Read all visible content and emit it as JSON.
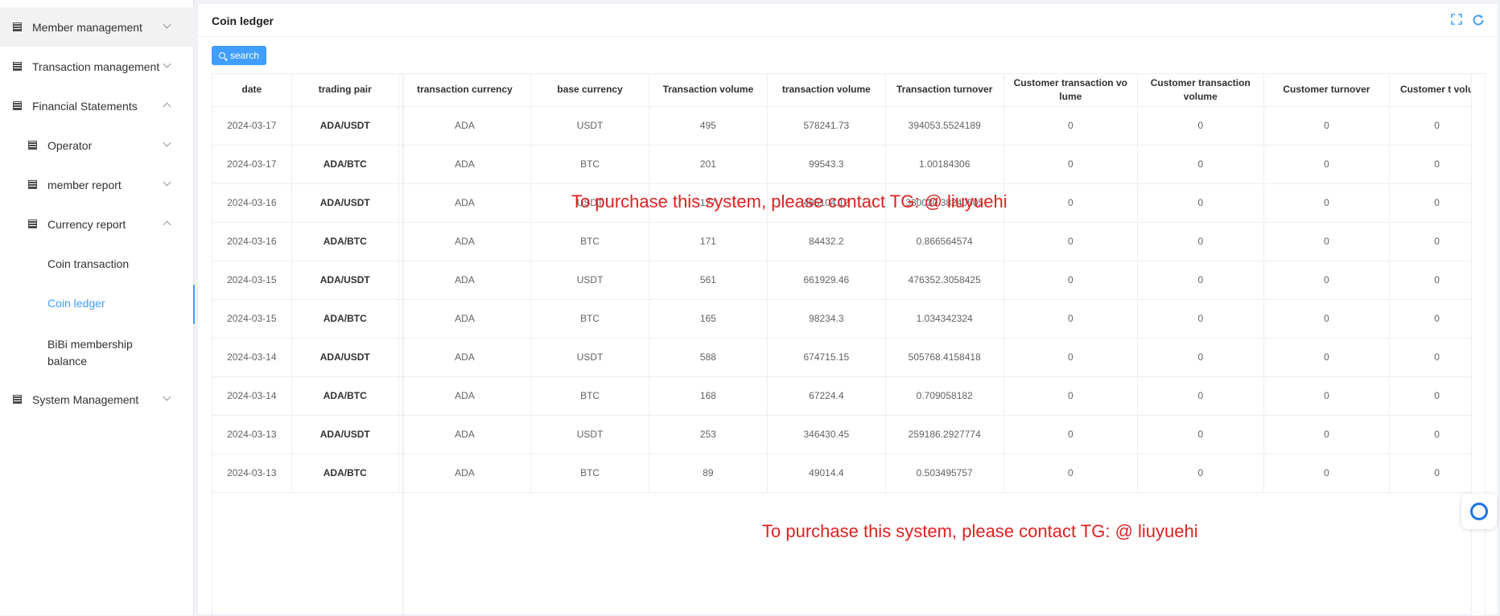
{
  "sidebar": {
    "items": [
      {
        "label": "Member management",
        "expanded": false
      },
      {
        "label": "Transaction management",
        "expanded": false
      },
      {
        "label": "Financial Statements",
        "expanded": true
      },
      {
        "label": "Operator",
        "expanded": false
      },
      {
        "label": "member report",
        "expanded": false
      },
      {
        "label": "Currency report",
        "expanded": true
      },
      {
        "label": "System Management",
        "expanded": false
      }
    ],
    "sub_items": [
      {
        "label": "Coin transaction"
      },
      {
        "label": "Coin ledger",
        "active": true
      },
      {
        "label": "BiBi membership balance"
      }
    ]
  },
  "panel": {
    "title": "Coin ledger",
    "search_label": "search",
    "icons": [
      "fullscreen-icon",
      "refresh-icon"
    ]
  },
  "table": {
    "columns": [
      "date",
      "trading pair",
      "transaction currency",
      "base currency",
      "Transaction volume",
      "transaction volume",
      "Transaction turnover",
      "Customer transaction volume",
      "Customer transaction volume",
      "Customer turnover",
      "Customer t volu"
    ],
    "rows": [
      [
        "2024-03-17",
        "ADA/USDT",
        "ADA",
        "USDT",
        "495",
        "578241.73",
        "394053.5524189",
        "0",
        "0",
        "0",
        "0"
      ],
      [
        "2024-03-17",
        "ADA/BTC",
        "ADA",
        "BTC",
        "201",
        "99543.3",
        "1.00184306",
        "0",
        "0",
        "0",
        "0"
      ],
      [
        "2024-03-16",
        "ADA/USDT",
        "ADA",
        "USDT",
        "177",
        "486104.12",
        "330030.38240505",
        "0",
        "0",
        "0",
        "0"
      ],
      [
        "2024-03-16",
        "ADA/BTC",
        "ADA",
        "BTC",
        "171",
        "84432.2",
        "0.866564574",
        "0",
        "0",
        "0",
        "0"
      ],
      [
        "2024-03-15",
        "ADA/USDT",
        "ADA",
        "USDT",
        "561",
        "661929.46",
        "476352.3058425",
        "0",
        "0",
        "0",
        "0"
      ],
      [
        "2024-03-15",
        "ADA/BTC",
        "ADA",
        "BTC",
        "165",
        "98234.3",
        "1.034342324",
        "0",
        "0",
        "0",
        "0"
      ],
      [
        "2024-03-14",
        "ADA/USDT",
        "ADA",
        "USDT",
        "588",
        "674715.15",
        "505768.4158418",
        "0",
        "0",
        "0",
        "0"
      ],
      [
        "2024-03-14",
        "ADA/BTC",
        "ADA",
        "BTC",
        "168",
        "67224.4",
        "0.709058182",
        "0",
        "0",
        "0",
        "0"
      ],
      [
        "2024-03-13",
        "ADA/USDT",
        "ADA",
        "USDT",
        "253",
        "346430.45",
        "259186.2927774",
        "0",
        "0",
        "0",
        "0"
      ],
      [
        "2024-03-13",
        "ADA/BTC",
        "ADA",
        "BTC",
        "89",
        "49014.4",
        "0.503495757",
        "0",
        "0",
        "0",
        "0"
      ]
    ]
  },
  "watermarks": [
    "To purchase this system, please contact TG: @ liuyuehi",
    "To purchase this system, please contact TG: @ liuyuehi"
  ],
  "colors": {
    "accent": "#409eff",
    "watermark": "#e02020"
  }
}
